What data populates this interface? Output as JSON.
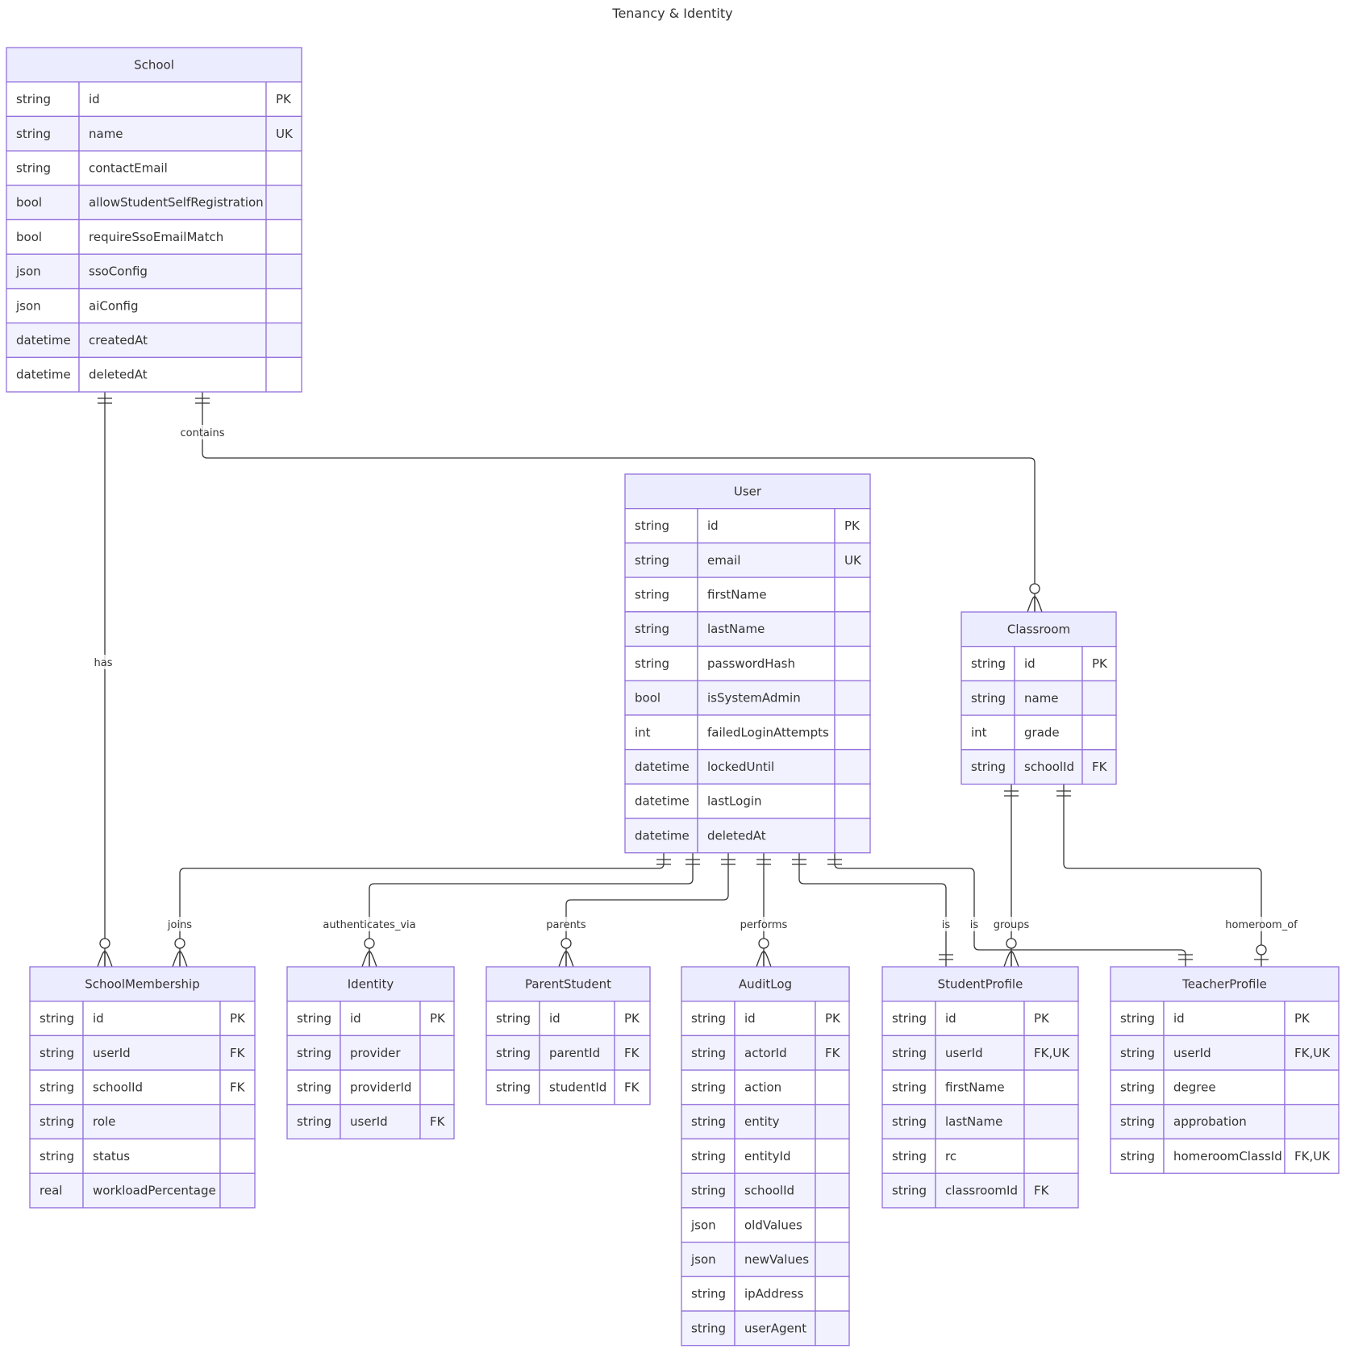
{
  "title": "Tenancy & Identity",
  "colors": {
    "header_fill": "#ECECFF",
    "row_odd": "#ffffff",
    "row_even": "#F2F2FF",
    "border": "#9370DB",
    "line": "#333333"
  },
  "entities": {
    "School": {
      "name": "School",
      "attrs": [
        [
          "string",
          "id",
          "PK"
        ],
        [
          "string",
          "name",
          "UK"
        ],
        [
          "string",
          "contactEmail",
          ""
        ],
        [
          "bool",
          "allowStudentSelfRegistration",
          ""
        ],
        [
          "bool",
          "requireSsoEmailMatch",
          ""
        ],
        [
          "json",
          "ssoConfig",
          ""
        ],
        [
          "json",
          "aiConfig",
          ""
        ],
        [
          "datetime",
          "createdAt",
          ""
        ],
        [
          "datetime",
          "deletedAt",
          ""
        ]
      ]
    },
    "User": {
      "name": "User",
      "attrs": [
        [
          "string",
          "id",
          "PK"
        ],
        [
          "string",
          "email",
          "UK"
        ],
        [
          "string",
          "firstName",
          ""
        ],
        [
          "string",
          "lastName",
          ""
        ],
        [
          "string",
          "passwordHash",
          ""
        ],
        [
          "bool",
          "isSystemAdmin",
          ""
        ],
        [
          "int",
          "failedLoginAttempts",
          ""
        ],
        [
          "datetime",
          "lockedUntil",
          ""
        ],
        [
          "datetime",
          "lastLogin",
          ""
        ],
        [
          "datetime",
          "deletedAt",
          ""
        ]
      ]
    },
    "Classroom": {
      "name": "Classroom",
      "attrs": [
        [
          "string",
          "id",
          "PK"
        ],
        [
          "string",
          "name",
          ""
        ],
        [
          "int",
          "grade",
          ""
        ],
        [
          "string",
          "schoolId",
          "FK"
        ]
      ]
    },
    "SchoolMembership": {
      "name": "SchoolMembership",
      "attrs": [
        [
          "string",
          "id",
          "PK"
        ],
        [
          "string",
          "userId",
          "FK"
        ],
        [
          "string",
          "schoolId",
          "FK"
        ],
        [
          "string",
          "role",
          ""
        ],
        [
          "string",
          "status",
          ""
        ],
        [
          "real",
          "workloadPercentage",
          ""
        ]
      ]
    },
    "Identity": {
      "name": "Identity",
      "attrs": [
        [
          "string",
          "id",
          "PK"
        ],
        [
          "string",
          "provider",
          ""
        ],
        [
          "string",
          "providerId",
          ""
        ],
        [
          "string",
          "userId",
          "FK"
        ]
      ]
    },
    "ParentStudent": {
      "name": "ParentStudent",
      "attrs": [
        [
          "string",
          "id",
          "PK"
        ],
        [
          "string",
          "parentId",
          "FK"
        ],
        [
          "string",
          "studentId",
          "FK"
        ]
      ]
    },
    "AuditLog": {
      "name": "AuditLog",
      "attrs": [
        [
          "string",
          "id",
          "PK"
        ],
        [
          "string",
          "actorId",
          "FK"
        ],
        [
          "string",
          "action",
          ""
        ],
        [
          "string",
          "entity",
          ""
        ],
        [
          "string",
          "entityId",
          ""
        ],
        [
          "string",
          "schoolId",
          ""
        ],
        [
          "json",
          "oldValues",
          ""
        ],
        [
          "json",
          "newValues",
          ""
        ],
        [
          "string",
          "ipAddress",
          ""
        ],
        [
          "string",
          "userAgent",
          ""
        ]
      ]
    },
    "StudentProfile": {
      "name": "StudentProfile",
      "attrs": [
        [
          "string",
          "id",
          "PK"
        ],
        [
          "string",
          "userId",
          "FK,UK"
        ],
        [
          "string",
          "firstName",
          ""
        ],
        [
          "string",
          "lastName",
          ""
        ],
        [
          "string",
          "rc",
          ""
        ],
        [
          "string",
          "classroomId",
          "FK"
        ]
      ]
    },
    "TeacherProfile": {
      "name": "TeacherProfile",
      "attrs": [
        [
          "string",
          "id",
          "PK"
        ],
        [
          "string",
          "userId",
          "FK,UK"
        ],
        [
          "string",
          "degree",
          ""
        ],
        [
          "string",
          "approbation",
          ""
        ],
        [
          "string",
          "homeroomClassId",
          "FK,UK"
        ]
      ]
    }
  },
  "relationships": [
    {
      "from": "School",
      "to": "SchoolMembership",
      "label": "has",
      "from_card": "exactly-one",
      "to_card": "zero-or-more"
    },
    {
      "from": "School",
      "to": "Classroom",
      "label": "contains",
      "from_card": "exactly-one",
      "to_card": "zero-or-more"
    },
    {
      "from": "User",
      "to": "SchoolMembership",
      "label": "joins",
      "from_card": "exactly-one",
      "to_card": "zero-or-more"
    },
    {
      "from": "User",
      "to": "Identity",
      "label": "authenticates_via",
      "from_card": "exactly-one",
      "to_card": "zero-or-more"
    },
    {
      "from": "User",
      "to": "ParentStudent",
      "label": "parents",
      "from_card": "exactly-one",
      "to_card": "zero-or-more"
    },
    {
      "from": "User",
      "to": "AuditLog",
      "label": "performs",
      "from_card": "exactly-one",
      "to_card": "zero-or-more"
    },
    {
      "from": "User",
      "to": "StudentProfile",
      "label": "is",
      "from_card": "exactly-one",
      "to_card": "exactly-one"
    },
    {
      "from": "User",
      "to": "TeacherProfile",
      "label": "is",
      "from_card": "exactly-one",
      "to_card": "exactly-one"
    },
    {
      "from": "Classroom",
      "to": "StudentProfile",
      "label": "groups",
      "from_card": "exactly-one",
      "to_card": "zero-or-more"
    },
    {
      "from": "Classroom",
      "to": "TeacherProfile",
      "label": "homeroom_of",
      "from_card": "exactly-one",
      "to_card": "zero-or-one"
    }
  ]
}
